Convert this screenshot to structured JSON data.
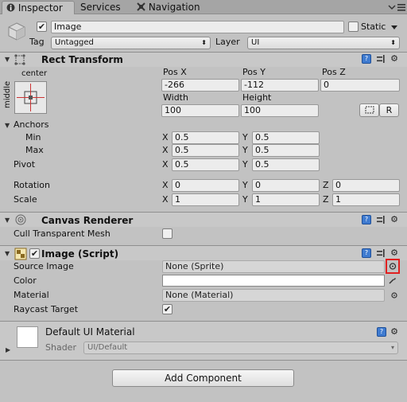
{
  "tabs": [
    {
      "label": "Inspector",
      "icon": "info-icon"
    },
    {
      "label": "Services",
      "icon": ""
    },
    {
      "label": "Navigation",
      "icon": "navigation-icon"
    }
  ],
  "gameobject": {
    "active": true,
    "name": "Image",
    "static_label": "Static",
    "static_checked": false,
    "tag_label": "Tag",
    "tag_value": "Untagged",
    "layer_label": "Layer",
    "layer_value": "UI"
  },
  "rect_transform": {
    "title": "Rect Transform",
    "anchor_preset_top": "center",
    "anchor_preset_side": "middle",
    "posx_label": "Pos X",
    "posy_label": "Pos Y",
    "posz_label": "Pos Z",
    "posx": "-266",
    "posy": "-112",
    "posz": "0",
    "width_label": "Width",
    "height_label": "Height",
    "width": "100",
    "height": "100",
    "raw_button": "R",
    "anchors_label": "Anchors",
    "min_label": "Min",
    "max_label": "Max",
    "min_x": "0.5",
    "min_y": "0.5",
    "max_x": "0.5",
    "max_y": "0.5",
    "pivot_label": "Pivot",
    "pivot_x": "0.5",
    "pivot_y": "0.5",
    "rotation_label": "Rotation",
    "rot_x": "0",
    "rot_y": "0",
    "rot_z": "0",
    "scale_label": "Scale",
    "scale_x": "1",
    "scale_y": "1",
    "scale_z": "1",
    "x": "X",
    "y": "Y",
    "z": "Z"
  },
  "canvas_renderer": {
    "title": "Canvas Renderer",
    "cull_label": "Cull Transparent Mesh",
    "cull_checked": false
  },
  "image_script": {
    "title": "Image (Script)",
    "enabled": true,
    "source_image_label": "Source Image",
    "source_image_value": "None (Sprite)",
    "color_label": "Color",
    "color_value": "#ffffff",
    "material_label": "Material",
    "material_value": "None (Material)",
    "raycast_label": "Raycast Target",
    "raycast_checked": true,
    "highlight_color": "#e02020"
  },
  "material": {
    "title": "Default UI Material",
    "shader_label": "Shader",
    "shader_value": "UI/Default"
  },
  "add_component_label": "Add Component"
}
